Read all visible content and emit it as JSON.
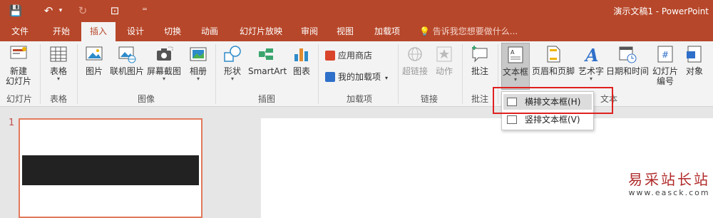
{
  "colors": {
    "accent": "#b7472a",
    "ribbon_bg": "#f3f3f3",
    "highlight_box": "#e02020"
  },
  "window": {
    "title": "演示文稿1 - PowerPoint"
  },
  "qat": {
    "save": "💾",
    "undo": "↶",
    "undo_arrow": "▾",
    "redo": "↻",
    "presenter": "⊡",
    "customize": "⁼"
  },
  "tabs": [
    "文件",
    "开始",
    "插入",
    "设计",
    "切换",
    "动画",
    "幻灯片放映",
    "审阅",
    "视图",
    "加载项"
  ],
  "active_tab": "插入",
  "tell_me": "告诉我您想要做什么...",
  "ribbon": {
    "new_slide": "新建\n幻灯片",
    "table": "表格",
    "picture": "图片",
    "online_picture": "联机图片",
    "screenshot": "屏幕截图",
    "album": "相册",
    "shapes": "形状",
    "smartart": "SmartArt",
    "chart": "图表",
    "store": "应用商店",
    "my_addins": "我的加载项",
    "hyperlink": "超链接",
    "action": "动作",
    "comment": "批注",
    "textbox": "文本框",
    "header_footer": "页眉和页脚",
    "wordart": "艺术字",
    "datetime": "日期和时间",
    "slide_number": "幻灯片\n编号",
    "object": "对象",
    "groups": {
      "slides": "幻灯片",
      "tables": "表格",
      "images": "图像",
      "illustrations": "插图",
      "addins": "加载项",
      "links": "链接",
      "comments": "批注",
      "text": "文本"
    }
  },
  "textbox_menu": {
    "horizontal": "横排文本框(H)",
    "vertical": "竖排文本框(V)"
  },
  "slides_panel": {
    "slide_number": "1"
  },
  "watermark": {
    "line1": "易采站长站",
    "line2": "www.easck.com"
  }
}
